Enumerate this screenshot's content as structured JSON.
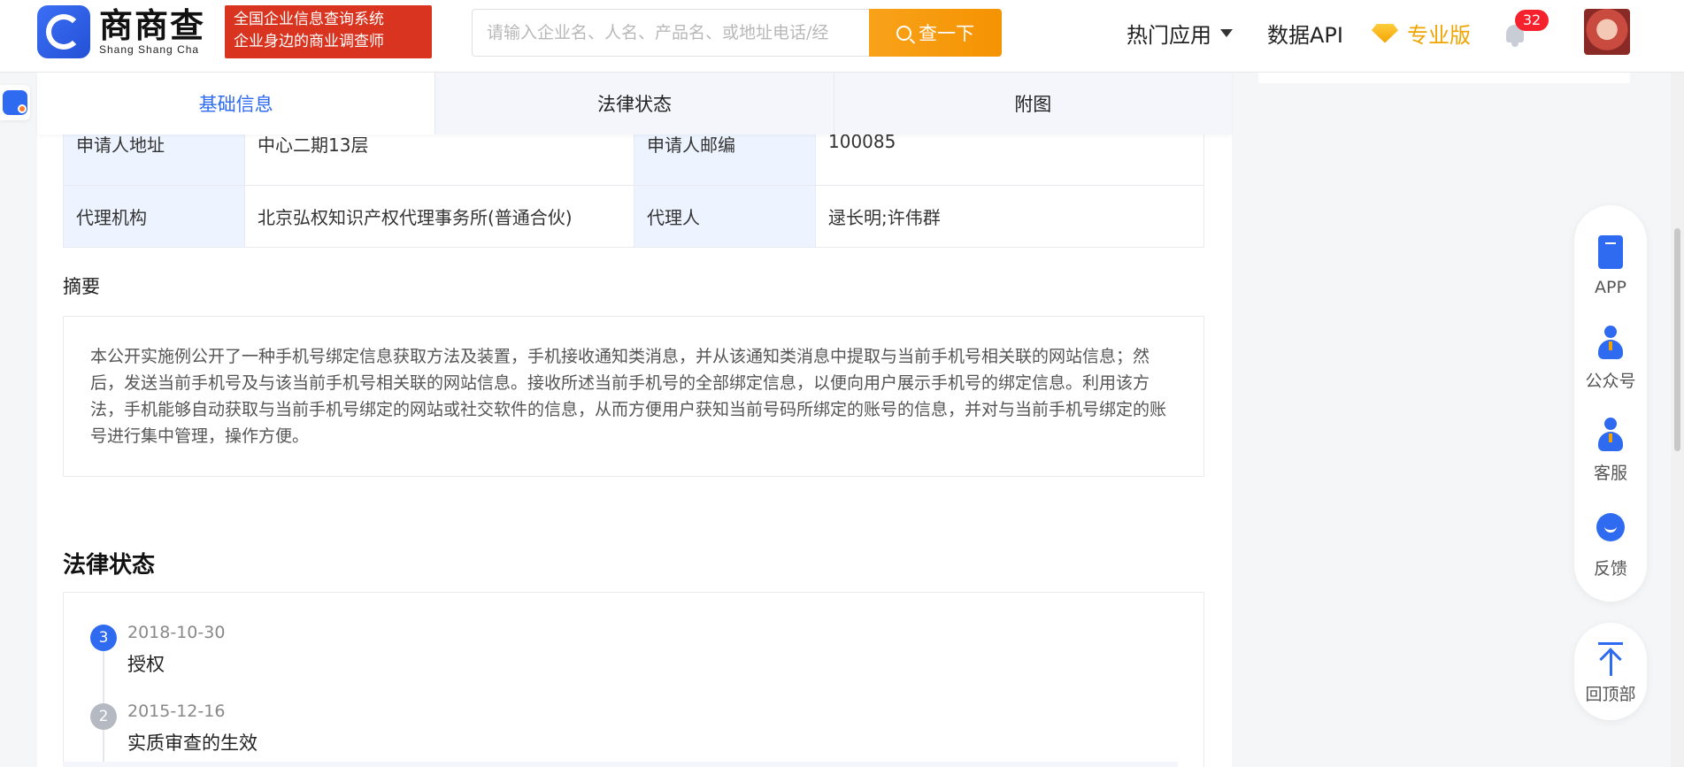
{
  "header": {
    "logo_cn": "商商查",
    "logo_en": "Shang Shang Cha",
    "slogan_line1": "全国企业信息查询系统",
    "slogan_line2": "企业身边的商业调查师",
    "search_placeholder": "请输入企业名、人名、产品名、或地址电话/经",
    "search_button": "查一下",
    "nav_hot": "热门应用",
    "nav_api": "数据API",
    "nav_pro": "专业版",
    "notification_count": "32"
  },
  "tabs": [
    {
      "label": "基础信息",
      "active": true
    },
    {
      "label": "法律状态",
      "active": false
    },
    {
      "label": "附图",
      "active": false
    }
  ],
  "info_table": {
    "row1": {
      "label1": "申请人地址",
      "value1_line1": "中心二期13层",
      "label2": "申请人邮编",
      "value2": "100085"
    },
    "row2": {
      "label1": "代理机构",
      "value1": "北京弘权知识产权代理事务所(普通合伙)",
      "label2": "代理人",
      "value2": "逯长明;许伟群"
    }
  },
  "abstract": {
    "title": "摘要",
    "text": "本公开实施例公开了一种手机号绑定信息获取方法及装置，手机接收通知类消息，并从该通知类消息中提取与当前手机号相关联的网站信息；然后，发送当前手机号及与该当前手机号相关联的网站信息。接收所述当前手机号的全部绑定信息，以便向用户展示手机号的绑定信息。利用该方法，手机能够自动获取与当前手机号绑定的网站或社交软件的信息，从而方便用户获知当前号码所绑定的账号的信息，并对与当前手机号绑定的账号进行集中管理，操作方便。"
  },
  "legal_status": {
    "title": "法律状态",
    "items": [
      {
        "num": "3",
        "date": "2018-10-30",
        "status": "授权",
        "color": "#2f6bf0"
      },
      {
        "num": "2",
        "date": "2015-12-16",
        "status": "实质审查的生效",
        "color": "#b5b9c2"
      }
    ]
  },
  "float_bar": {
    "app": "APP",
    "wechat": "公众号",
    "service": "客服",
    "feedback": "反馈",
    "back_top": "回顶部"
  }
}
